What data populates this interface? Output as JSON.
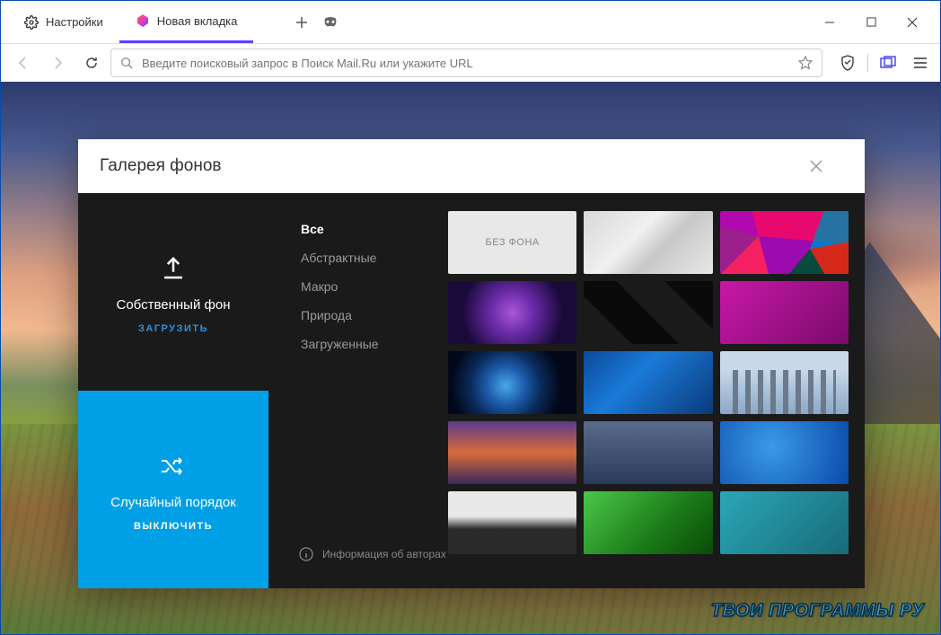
{
  "tabs": [
    {
      "label": "Настройки"
    },
    {
      "label": "Новая вкладка"
    }
  ],
  "urlbar": {
    "placeholder": "Введите поисковый запрос в Поиск Mail.Ru или укажите URL"
  },
  "modal": {
    "title": "Галерея фонов",
    "custom": {
      "title": "Собственный фон",
      "action": "Загрузить"
    },
    "random": {
      "title": "Случайный порядок",
      "action": "Выключить"
    },
    "categories": [
      "Все",
      "Абстрактные",
      "Макро",
      "Природа",
      "Загруженные"
    ],
    "info": "Информация об авторах",
    "nobg_label": "БЕЗ ФОНА"
  },
  "watermark": "ТВОИ ПРОГРАММЫ РУ"
}
